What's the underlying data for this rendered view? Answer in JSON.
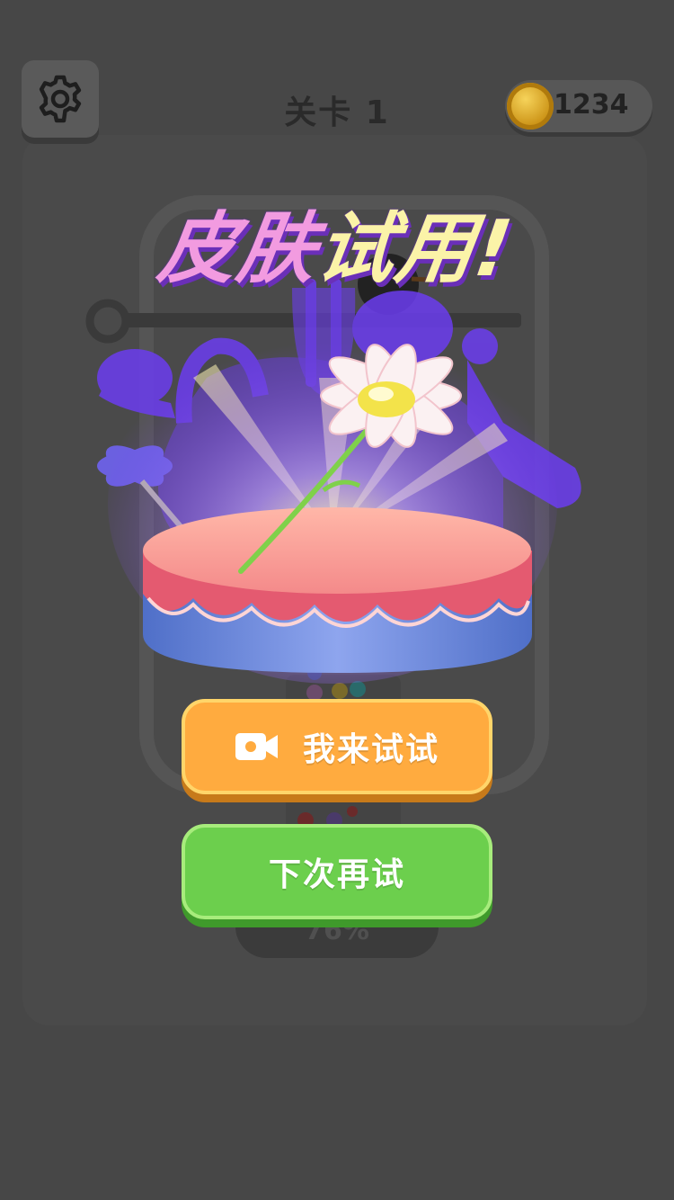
{
  "header": {
    "settings_icon": "gear-icon",
    "level_title": "关卡 1",
    "coin_icon": "gold-coin-icon",
    "coin_count": "1234"
  },
  "background_game": {
    "progress_text": "76%"
  },
  "popup": {
    "title_part1": "皮肤",
    "title_part2": "试用!",
    "prize_item": "daisy-flower",
    "pedestal": "cake-pedestal",
    "try_button_icon": "video-camera-icon",
    "try_button_label": "我来试试",
    "next_button_label": "下次再试"
  },
  "colors": {
    "background": "#474747",
    "try_button": "#ffab3f",
    "next_button": "#6ccf4d",
    "title_pink": "#f29be0",
    "title_yellow": "#fbf3a8",
    "title_outline": "#6a2fb8"
  }
}
